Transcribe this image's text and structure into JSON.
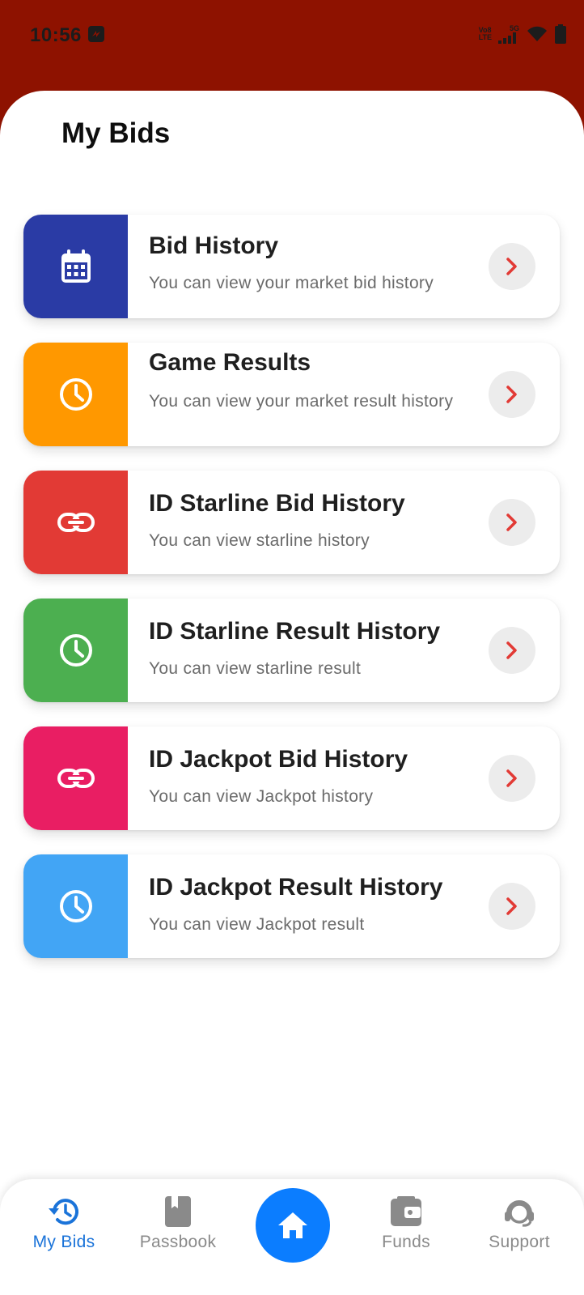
{
  "status_bar": {
    "time": "10:56",
    "network_top": "Vo8",
    "network_bottom": "LTE",
    "network_gen": "5G"
  },
  "page": {
    "title": "My Bids"
  },
  "cards": [
    {
      "title": "Bid History",
      "subtitle": "You can view your market bid history",
      "color": "#2a3ba5",
      "icon": "calendar-icon"
    },
    {
      "title": "Game Results",
      "subtitle": "You can view your market result history",
      "color": "#ff9800",
      "icon": "clock-icon"
    },
    {
      "title": "ID Starline Bid History",
      "subtitle": "You can view starline history",
      "color": "#e23a35",
      "icon": "link-icon"
    },
    {
      "title": "ID Starline Result History",
      "subtitle": "You can view starline result",
      "color": "#4caf50",
      "icon": "clock-icon"
    },
    {
      "title": "ID Jackpot Bid History",
      "subtitle": "You can view Jackpot history",
      "color": "#e91e63",
      "icon": "link-icon"
    },
    {
      "title": "ID Jackpot Result History",
      "subtitle": "You can view Jackpot result",
      "color": "#42a5f5",
      "icon": "clock-icon"
    }
  ],
  "bottom_nav": {
    "items": [
      {
        "label": "My Bids",
        "icon": "history-icon",
        "active": true
      },
      {
        "label": "Passbook",
        "icon": "book-icon",
        "active": false
      },
      {
        "label": "Funds",
        "icon": "wallet-icon",
        "active": false
      },
      {
        "label": "Support",
        "icon": "support-icon",
        "active": false
      }
    ],
    "home_icon": "home-icon"
  },
  "colors": {
    "header_bg": "#8e1200",
    "accent": "#0b7dff",
    "active_nav": "#1a73d9",
    "chevron": "#e23a35"
  }
}
